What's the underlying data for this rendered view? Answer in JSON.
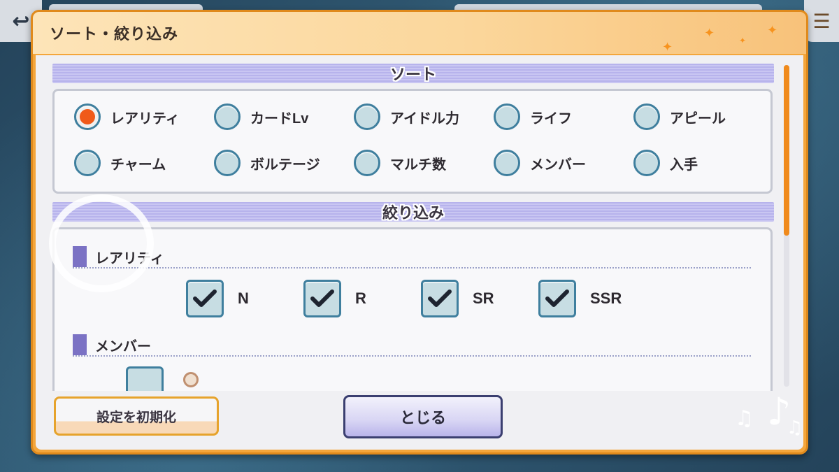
{
  "dialog": {
    "title": "ソート・絞り込み"
  },
  "sort": {
    "heading": "ソート",
    "selected_index": 0,
    "options": [
      {
        "label": "レアリティ",
        "selected": true
      },
      {
        "label": "カードLv",
        "selected": false
      },
      {
        "label": "アイドル力",
        "selected": false
      },
      {
        "label": "ライフ",
        "selected": false
      },
      {
        "label": "アピール",
        "selected": false
      },
      {
        "label": "チャーム",
        "selected": false
      },
      {
        "label": "ボルテージ",
        "selected": false
      },
      {
        "label": "マルチ数",
        "selected": false
      },
      {
        "label": "メンバー",
        "selected": false
      },
      {
        "label": "入手",
        "selected": false
      }
    ]
  },
  "filter": {
    "heading": "絞り込み",
    "rarity": {
      "label": "レアリティ",
      "options": [
        {
          "label": "N",
          "checked": true
        },
        {
          "label": "R",
          "checked": true
        },
        {
          "label": "SR",
          "checked": true
        },
        {
          "label": "SSR",
          "checked": true
        }
      ]
    },
    "member": {
      "label": "メンバー"
    }
  },
  "footer": {
    "reset_label": "設定を初期化",
    "close_label": "とじる"
  },
  "icons": {
    "back": "back-arrow-icon",
    "menu": "menu-icon",
    "check": "check-icon",
    "note": "music-note-icon"
  },
  "colors": {
    "accent_orange": "#f4a63b",
    "radio_selected": "#f05a1a",
    "section_bar": "#b7b3ec",
    "control_border": "#3f7f9e"
  }
}
